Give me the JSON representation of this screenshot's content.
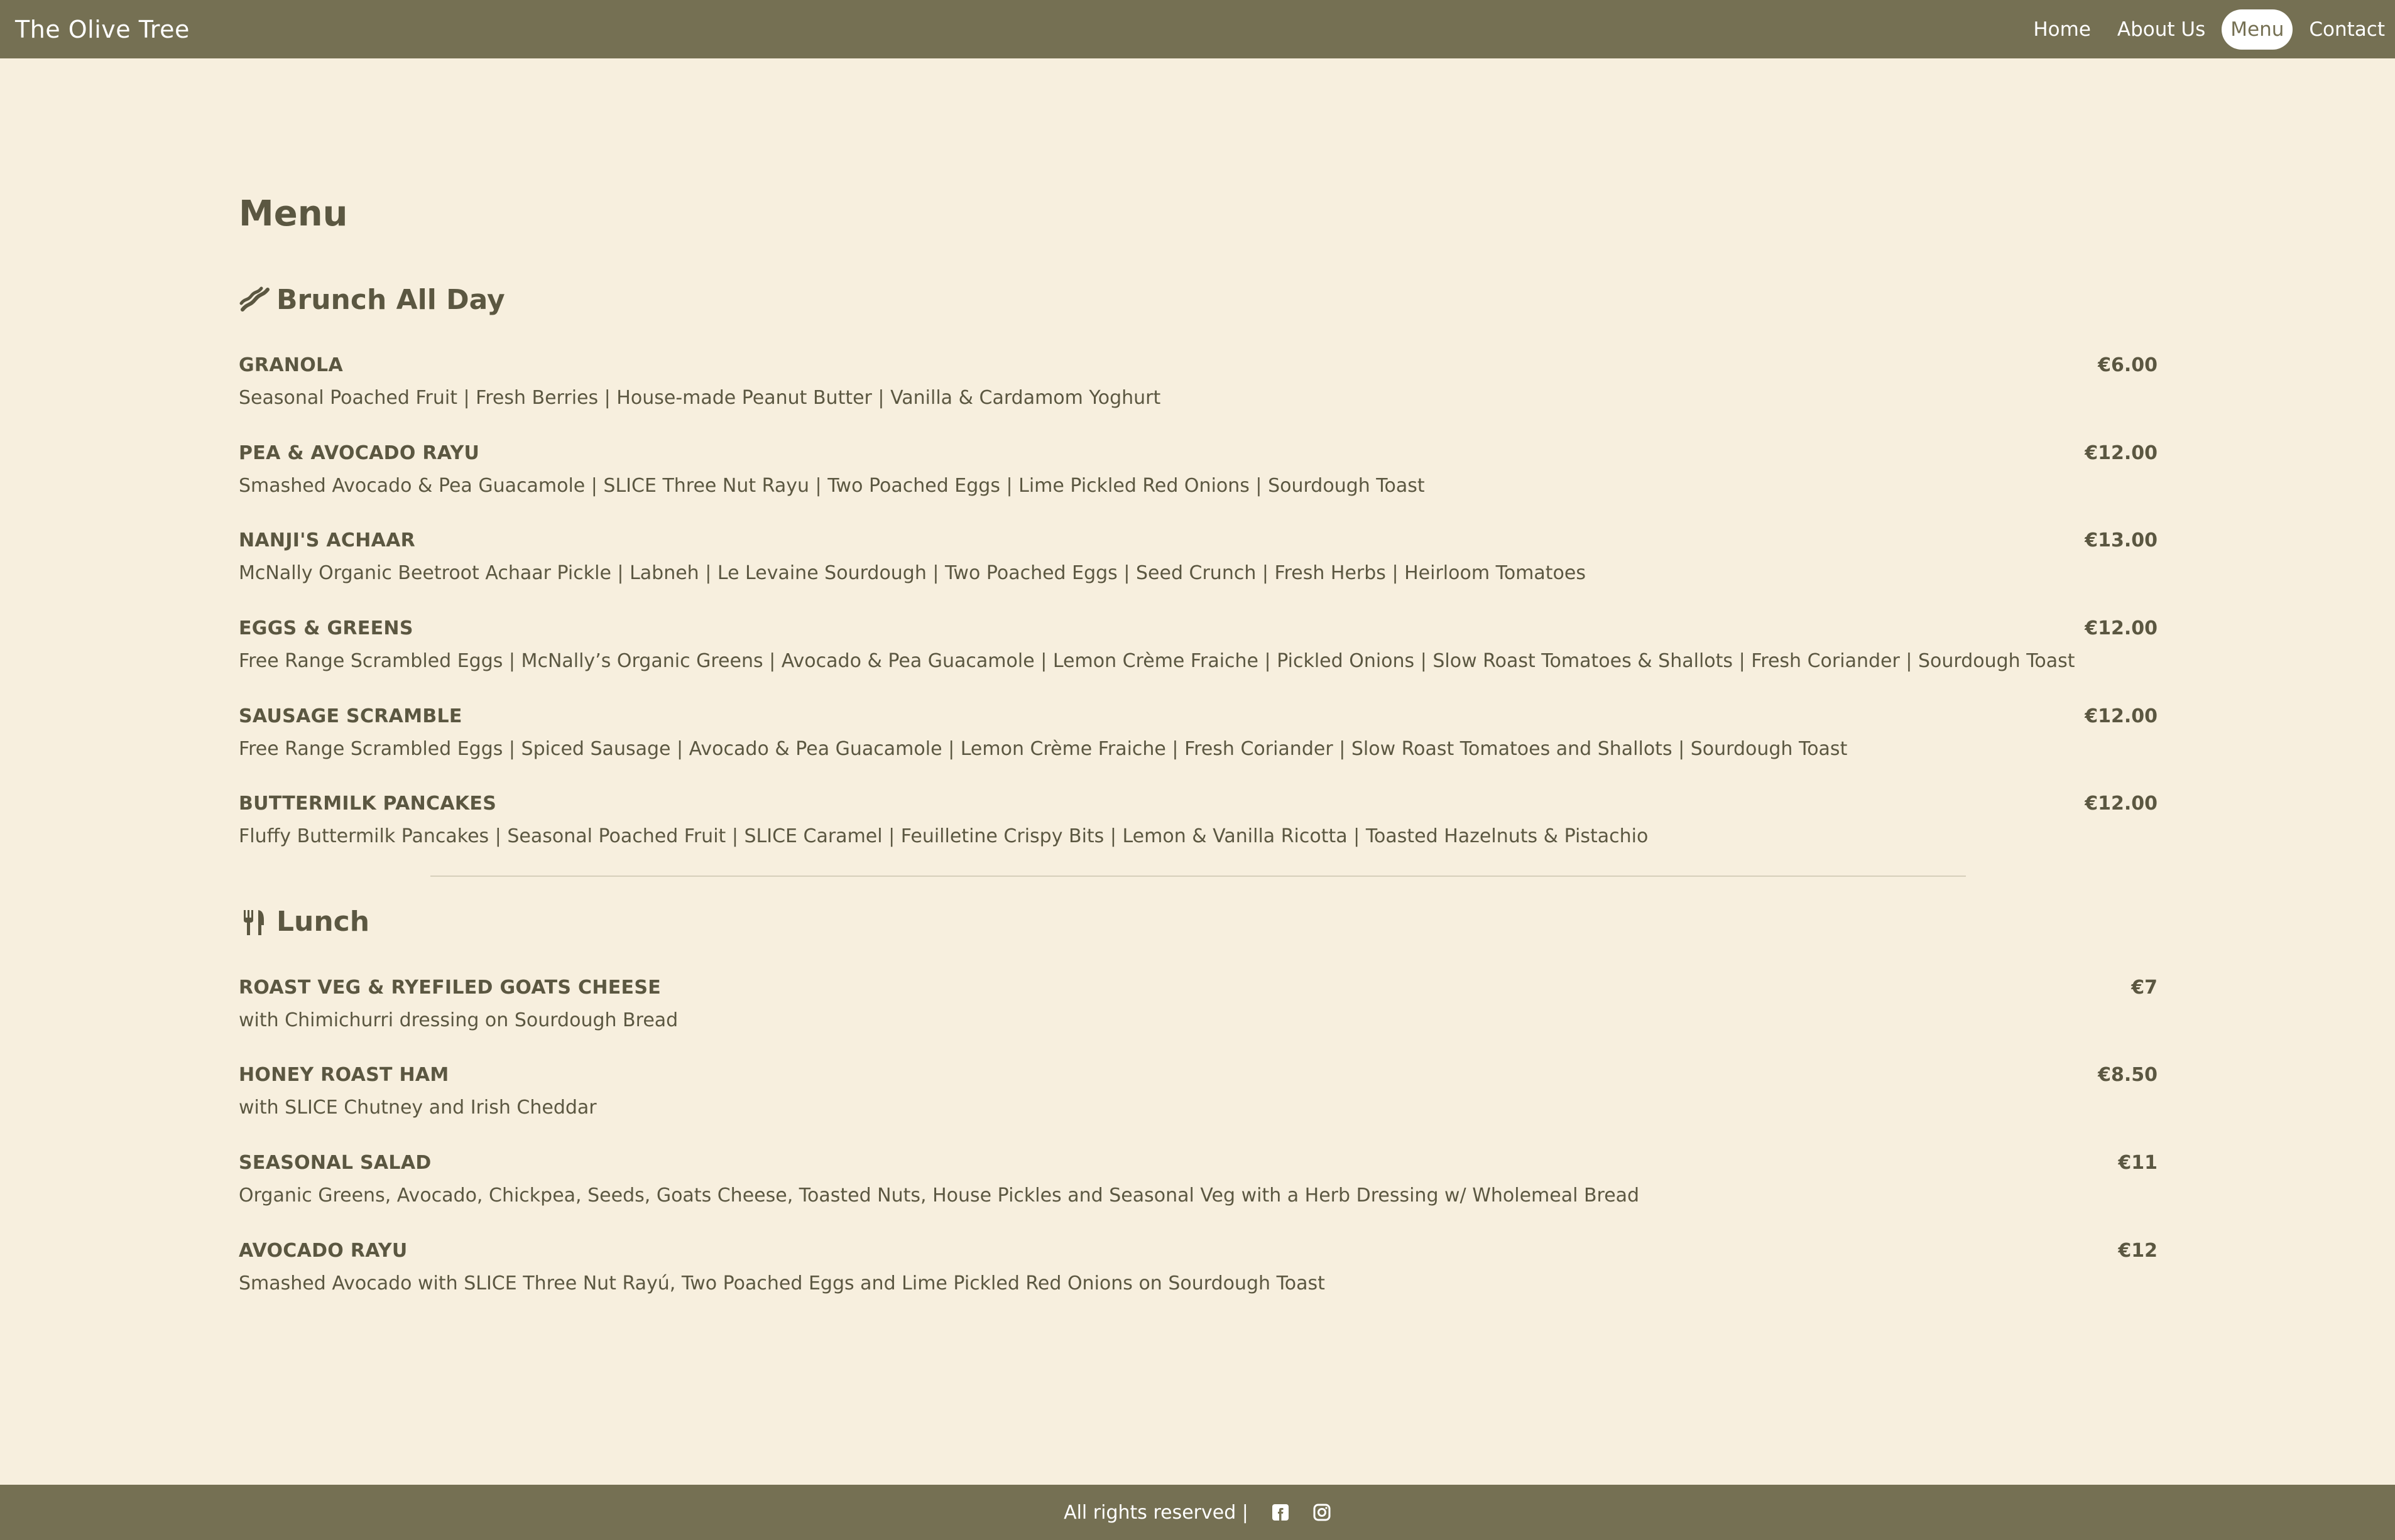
{
  "header": {
    "brand": "The Olive Tree",
    "nav": [
      {
        "label": "Home"
      },
      {
        "label": "About Us"
      },
      {
        "label": "Menu",
        "active": true
      },
      {
        "label": "Contact"
      }
    ]
  },
  "page_title": "Menu",
  "sections": [
    {
      "title": "Brunch All Day",
      "icon": "bacon-icon",
      "items": [
        {
          "name": "GRANOLA",
          "price": "€6.00",
          "desc": "Seasonal Poached Fruit | Fresh Berries | House-made Peanut Butter | Vanilla & Cardamom Yoghurt"
        },
        {
          "name": "PEA & AVOCADO RAYU",
          "price": "€12.00",
          "desc": "Smashed Avocado & Pea Guacamole | SLICE Three Nut Rayu | Two Poached Eggs | Lime Pickled Red Onions | Sourdough Toast"
        },
        {
          "name": "NANJI'S ACHAAR",
          "price": "€13.00",
          "desc": "McNally Organic Beetroot Achaar Pickle | Labneh | Le Levaine Sourdough | Two Poached Eggs | Seed Crunch | Fresh Herbs | Heirloom Tomatoes"
        },
        {
          "name": "EGGS & GREENS",
          "price": "€12.00",
          "desc": "Free Range Scrambled Eggs | McNally’s Organic Greens | Avocado & Pea Guacamole | Lemon Crème Fraiche | Pickled Onions | Slow Roast Tomatoes & Shallots | Fresh Coriander | Sourdough Toast"
        },
        {
          "name": "SAUSAGE SCRAMBLE",
          "price": "€12.00",
          "desc": "Free Range Scrambled Eggs | Spiced Sausage | Avocado & Pea Guacamole | Lemon Crème Fraiche | Fresh Coriander | Slow Roast Tomatoes and Shallots | Sourdough Toast"
        },
        {
          "name": "BUTTERMILK PANCAKES",
          "price": "€12.00",
          "desc": "Fluffy Buttermilk Pancakes | Seasonal Poached Fruit | SLICE Caramel | Feuilletine Crispy Bits | Lemon & Vanilla Ricotta | Toasted Hazelnuts & Pistachio"
        }
      ]
    },
    {
      "title": "Lunch",
      "icon": "utensils-icon",
      "items": [
        {
          "name": "ROAST VEG & RYEFILED GOATS CHEESE",
          "price": "€7",
          "desc": "with Chimichurri dressing on Sourdough Bread"
        },
        {
          "name": "HONEY ROAST HAM",
          "price": "€8.50",
          "desc": "with SLICE Chutney and Irish Cheddar"
        },
        {
          "name": "SEASONAL SALAD",
          "price": "€11",
          "desc": "Organic Greens, Avocado, Chickpea, Seeds, Goats Cheese, Toasted Nuts, House Pickles and Seasonal Veg with a Herb Dressing w/ Wholemeal Bread"
        },
        {
          "name": "AVOCADO RAYU",
          "price": "€12",
          "desc": "Smashed Avocado with SLICE Three Nut Rayú, Two Poached Eggs and Lime Pickled Red Onions on Sourdough Toast"
        }
      ]
    }
  ],
  "footer": {
    "text": "All rights reserved |",
    "social": [
      "facebook-icon",
      "instagram-icon"
    ]
  },
  "colors": {
    "bar": "#757053",
    "background": "#f7efde",
    "text": "#5b5741"
  }
}
